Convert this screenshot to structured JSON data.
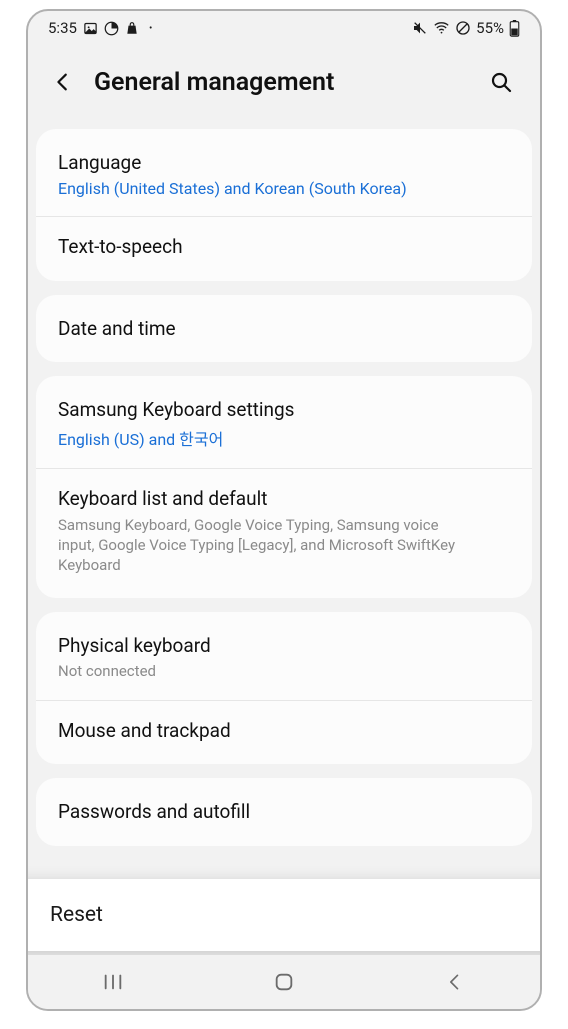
{
  "status": {
    "time": "5:35",
    "battery_text": "55%"
  },
  "header": {
    "title": "General management"
  },
  "sections": {
    "language": {
      "title": "Language",
      "sub": "English (United States) and Korean (South Korea)"
    },
    "tts": {
      "title": "Text-to-speech"
    },
    "datetime": {
      "title": "Date and time"
    },
    "samsung_kb": {
      "title": "Samsung Keyboard settings",
      "sub": "English (US) and 한국어"
    },
    "kb_list": {
      "title": "Keyboard list and default",
      "sub": "Samsung Keyboard, Google Voice Typing, Samsung voice input, Google Voice Typing [Legacy], and Microsoft SwiftKey Keyboard"
    },
    "physical_kb": {
      "title": "Physical keyboard",
      "sub": "Not connected"
    },
    "mouse": {
      "title": "Mouse and trackpad"
    },
    "passwords": {
      "title": "Passwords and autofill"
    }
  },
  "overlay": {
    "reset": "Reset"
  }
}
